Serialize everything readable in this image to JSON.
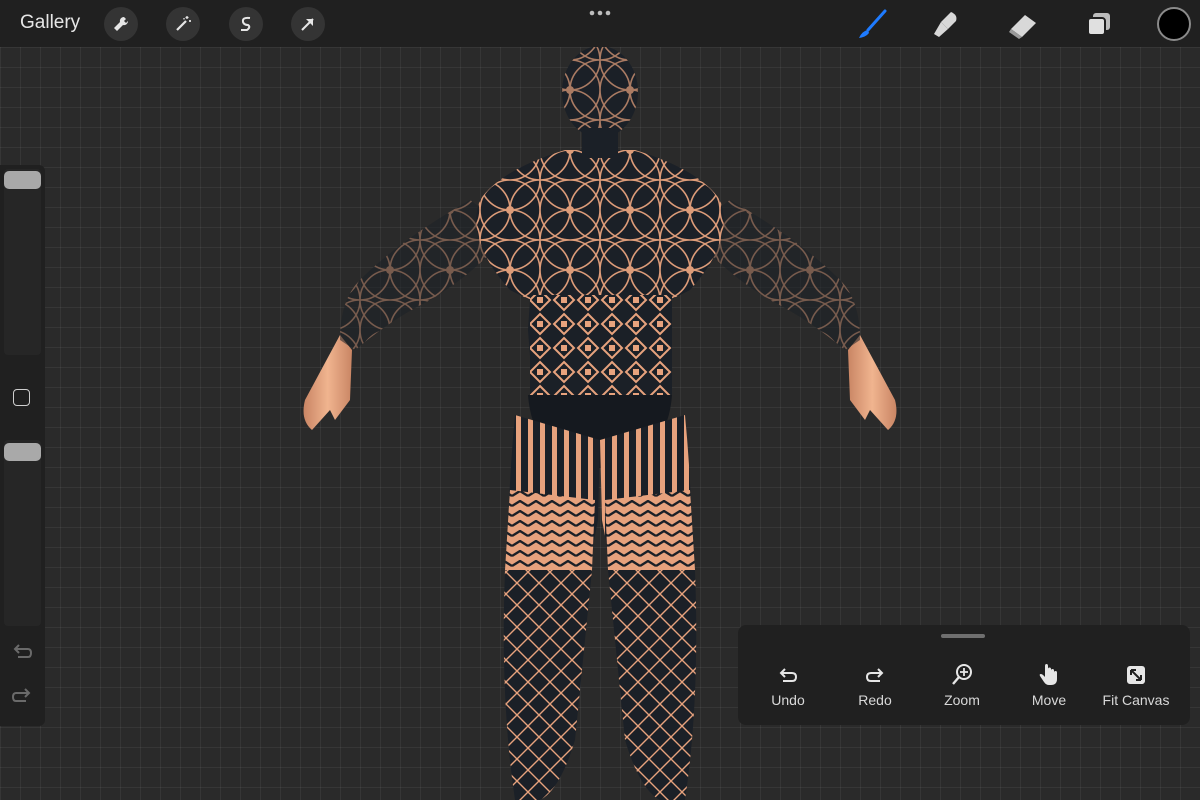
{
  "toolbar": {
    "gallery_label": "Gallery",
    "actions_icons": [
      "wrench-icon",
      "magic-wand-icon",
      "selection-s-icon",
      "arrow-cursor-icon"
    ],
    "more_icon": "more-dots-icon",
    "right_tools": [
      "brush-icon",
      "smudge-icon",
      "eraser-icon",
      "layers-icon"
    ],
    "active_tool": "brush-icon",
    "current_color": "#000000",
    "accent_color": "#1e7bff"
  },
  "sidebar": {
    "brush_size_slider": "size",
    "opacity_slider": "opacity",
    "modify_button": "square-icon",
    "undo_icon": "undo-arrow-icon",
    "redo_icon": "redo-arrow-icon"
  },
  "gesture_panel": {
    "buttons": [
      {
        "label": "Undo",
        "icon": "undo-icon"
      },
      {
        "label": "Redo",
        "icon": "redo-icon"
      },
      {
        "label": "Zoom",
        "icon": "zoom-icon"
      },
      {
        "label": "Move",
        "icon": "hand-icon"
      },
      {
        "label": "Fit Canvas",
        "icon": "fit-canvas-icon"
      }
    ]
  },
  "canvas": {
    "subject": "3d-figure-with-geometric-tattoos",
    "skin_color": "#e8a47f",
    "tattoo_color": "#1a1f26"
  }
}
